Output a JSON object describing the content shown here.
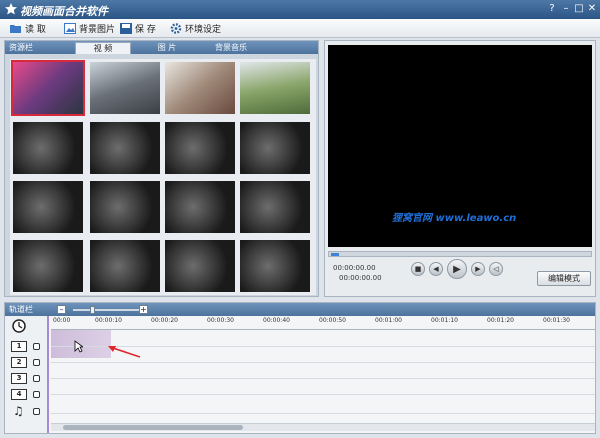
{
  "window": {
    "title": "视频画面合并软件",
    "buttons": [
      "?",
      "–",
      "□",
      "✕"
    ]
  },
  "menu": [
    {
      "label": "读 取",
      "icon": "folder-icon"
    },
    {
      "label": "背景图片",
      "icon": "picture-icon"
    },
    {
      "label": "保 存",
      "icon": "save-icon"
    },
    {
      "label": "环境设定",
      "icon": "gear-icon"
    }
  ],
  "resources": {
    "title": "资源栏",
    "tabs": [
      "视 频",
      "图 片",
      "背景音乐"
    ],
    "active_tab": 0
  },
  "preview": {
    "watermark": "狸窝官网 www.leawo.cn",
    "time_current": "00:00:00.00",
    "time_total": "00:00:00.00",
    "edit_mode": "编辑模式"
  },
  "timeline": {
    "title": "轨道栏",
    "zoom_minus": "–",
    "zoom_plus": "+",
    "ticks": [
      "00:00",
      "00:00:10",
      "00:00:20",
      "00:00:30",
      "00:00:40",
      "00:00:50",
      "00:01:00",
      "00:01:10",
      "00:01:20",
      "00:01:30"
    ],
    "tracks": [
      "1",
      "2",
      "3",
      "4",
      "♫"
    ]
  },
  "colors": {
    "accent": "#3d84d6",
    "selected": "#d6293a",
    "watermark": "#1f6fd9"
  }
}
